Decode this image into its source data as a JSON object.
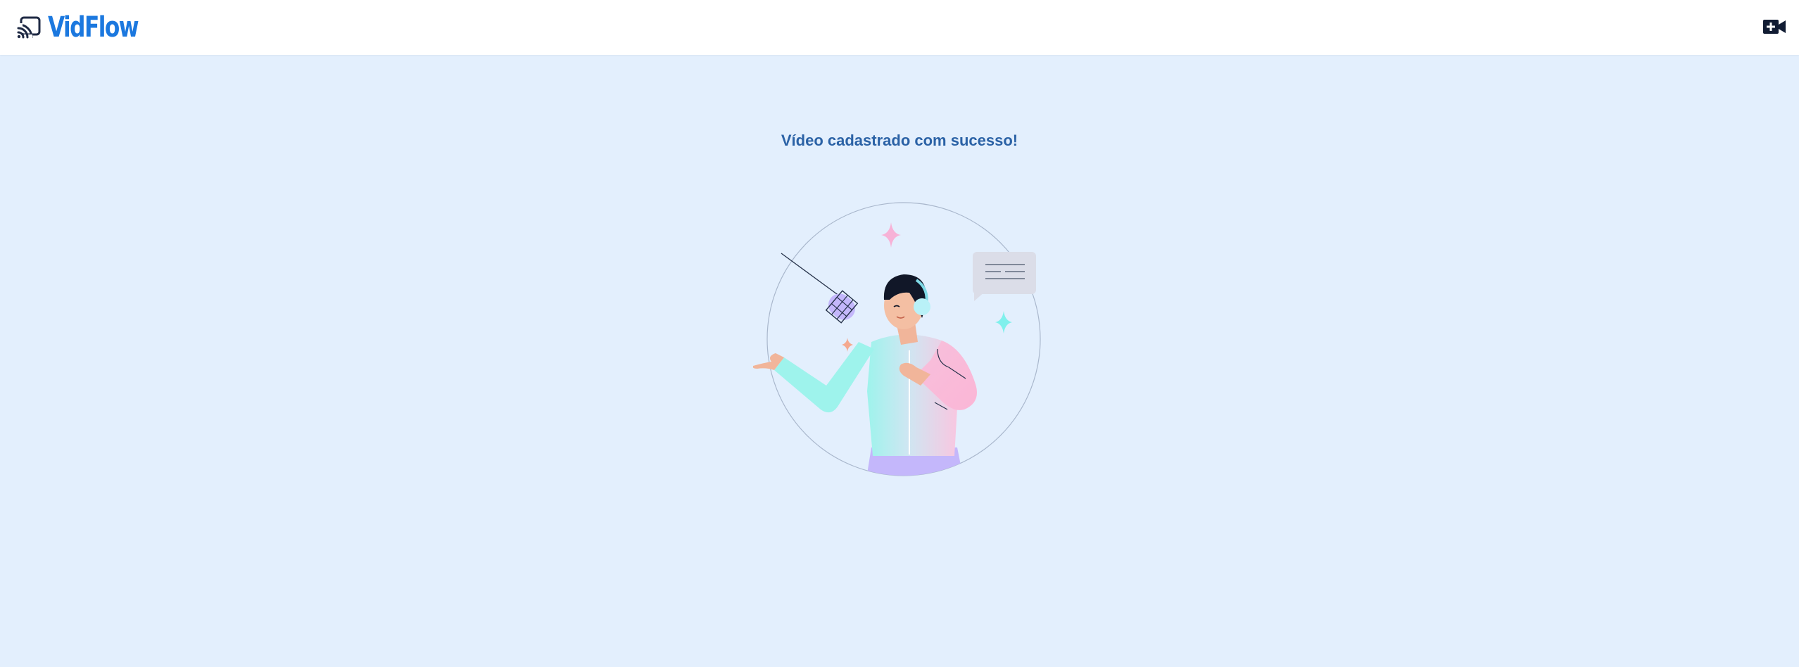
{
  "header": {
    "logo_text": "VidFlow",
    "logo_icon": "cast-icon",
    "add_video_icon": "video-plus-icon",
    "brand_color": "#1b78df"
  },
  "main": {
    "success_message": "Vídeo cadastrado com sucesso!",
    "illustration": "podcaster-illustration"
  },
  "colors": {
    "background": "#e3effd",
    "header_bg": "#ffffff",
    "message": "#2b62a6"
  }
}
